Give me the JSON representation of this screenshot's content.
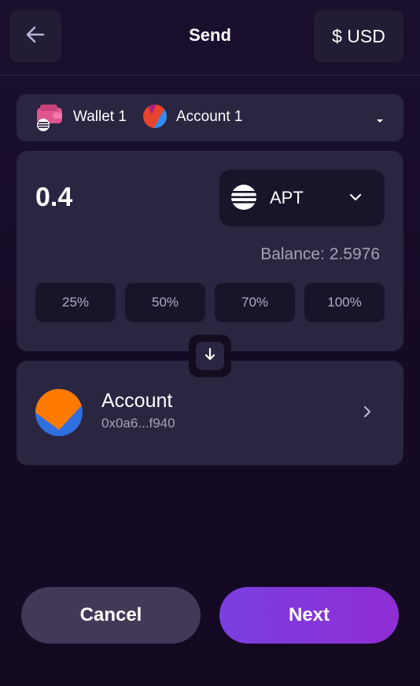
{
  "header": {
    "title": "Send",
    "back_icon": "arrow-left-icon",
    "currency_label": "$ USD"
  },
  "wallet_selector": {
    "wallet_label": "Wallet 1",
    "wallet_icon": "wallet-icon",
    "account_label": "Account 1",
    "account_icon": "account-avatar-icon",
    "caret_icon": "caret-down-icon"
  },
  "amount": {
    "value": "0.4",
    "token": {
      "symbol": "APT",
      "icon": "aptos-icon",
      "chevron_icon": "chevron-down-icon"
    },
    "balance_text": "Balance: 2.5976",
    "percent_options": [
      "25%",
      "50%",
      "70%",
      "100%"
    ]
  },
  "swap": {
    "icon": "arrow-down-icon"
  },
  "recipient": {
    "name": "Account",
    "address": "0x0a6...f940",
    "chevron_icon": "chevron-right-icon"
  },
  "actions": {
    "cancel_label": "Cancel",
    "next_label": "Next"
  },
  "colors": {
    "background": "#150a24",
    "card": "#2a2540",
    "accent_start": "#7a3fe0",
    "accent_end": "#8f2ed4"
  }
}
